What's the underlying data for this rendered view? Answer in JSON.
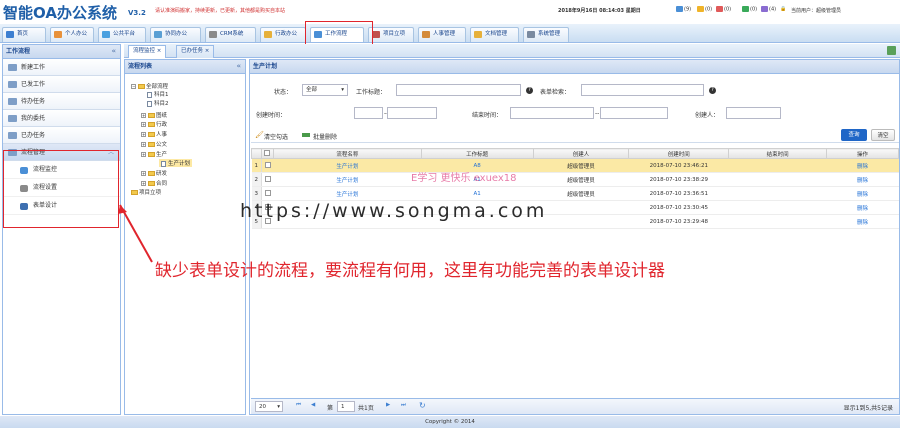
{
  "header": {
    "logo": "智能OA办公系统",
    "version": "V3.2",
    "notice": "请认准演码搬家，持续更新，已更新，其他都是购买自本站",
    "datetime": "2018年9月16日 08:14:03 星期日",
    "badges": [
      {
        "label": "(9)",
        "icon": "user-icon",
        "color": "#4a8fd6"
      },
      {
        "label": "(0)",
        "icon": "mail-icon",
        "color": "#f0b429"
      },
      {
        "label": "(0)",
        "icon": "calendar-icon",
        "color": "#e05a5a"
      },
      {
        "label": "(0)",
        "icon": "message-icon",
        "color": "#3aaa5a"
      },
      {
        "label": "(4)",
        "icon": "task-icon",
        "color": "#8a6cd1"
      }
    ],
    "current_user": "当前用户：超级管理员"
  },
  "main_tabs": [
    {
      "label": "首页",
      "color": "#3d7fd1"
    },
    {
      "label": "个人办公",
      "color": "#e8913a"
    },
    {
      "label": "公共平台",
      "color": "#4aa0e0"
    },
    {
      "label": "协同办公",
      "color": "#5a9fd4"
    },
    {
      "label": "CRM系统",
      "color": "#8a8a8a"
    },
    {
      "label": "行政办公",
      "color": "#e6b03a"
    },
    {
      "label": "工作流程",
      "color": "#4a8fd6"
    },
    {
      "label": "项目立项",
      "color": "#c0504d"
    },
    {
      "label": "人事管理",
      "color": "#d48a3a"
    },
    {
      "label": "文档管理",
      "color": "#e6b03a"
    },
    {
      "label": "系统管理",
      "color": "#7a8aa0"
    }
  ],
  "left_panel": {
    "title": "工作流程",
    "items": [
      "新建工作",
      "已发工作",
      "待办任务",
      "我的委托",
      "已办任务"
    ],
    "group": "流程管理",
    "sub_items": [
      "流程监控",
      "流程设置",
      "表单设计"
    ]
  },
  "sub_tabs": [
    "流程监控",
    "已办任务"
  ],
  "tree": {
    "title": "流程列表",
    "nodes": [
      "全部流程",
      "科目1",
      "科目2",
      "图纸",
      "行政",
      "人事",
      "公文",
      "生产",
      "生产计划",
      "研发",
      "合同",
      "项目立项"
    ]
  },
  "main": {
    "title": "生产计划",
    "search": {
      "status_label": "状态：",
      "status_value": "全部",
      "title_label": "工作标题：",
      "form_label": "表单检索：",
      "created_label": "创建时间：",
      "ended_label": "结束时间：",
      "creator_label": "创建人：",
      "dash": "--",
      "query": "查询",
      "clear": "清空"
    },
    "toolbar": {
      "clear_check": "清空勾选",
      "batch_delete": "批量删除"
    },
    "columns": [
      "流程名称",
      "工作标题",
      "创建人",
      "创建时间",
      "结束时间",
      "操作"
    ],
    "rows": [
      {
        "n": "1",
        "name": "生产计划",
        "title": "A8",
        "creator": "超级管理员",
        "created": "2018-07-10 23:46:21",
        "ended": "",
        "op": "删除"
      },
      {
        "n": "2",
        "name": "生产计划",
        "title": "A1",
        "creator": "超级管理员",
        "created": "2018-07-10 23:38:29",
        "ended": "",
        "op": "删除"
      },
      {
        "n": "3",
        "name": "生产计划",
        "title": "A1",
        "creator": "超级管理员",
        "created": "2018-07-10 23:36:51",
        "ended": "",
        "op": "删除"
      },
      {
        "n": "4",
        "name": "",
        "title": "",
        "creator": "",
        "created": "2018-07-10 23:30:45",
        "ended": "",
        "op": "删除"
      },
      {
        "n": "5",
        "name": "",
        "title": "",
        "creator": "",
        "created": "2018-07-10 23:29:48",
        "ended": "",
        "op": "删除"
      }
    ],
    "pager": {
      "page_size": "20",
      "page_prefix": "第",
      "page": "1",
      "page_suffix": "共1页",
      "summary": "显示1到5,共5记录"
    }
  },
  "annotation": "缺少表单设计的流程，要流程有何用，这里有功能完善的表单设计器",
  "watermark": "https://www.songma.com",
  "watermark2": "E学习 更快乐 exuex18",
  "footer": "Copyright © 2014"
}
